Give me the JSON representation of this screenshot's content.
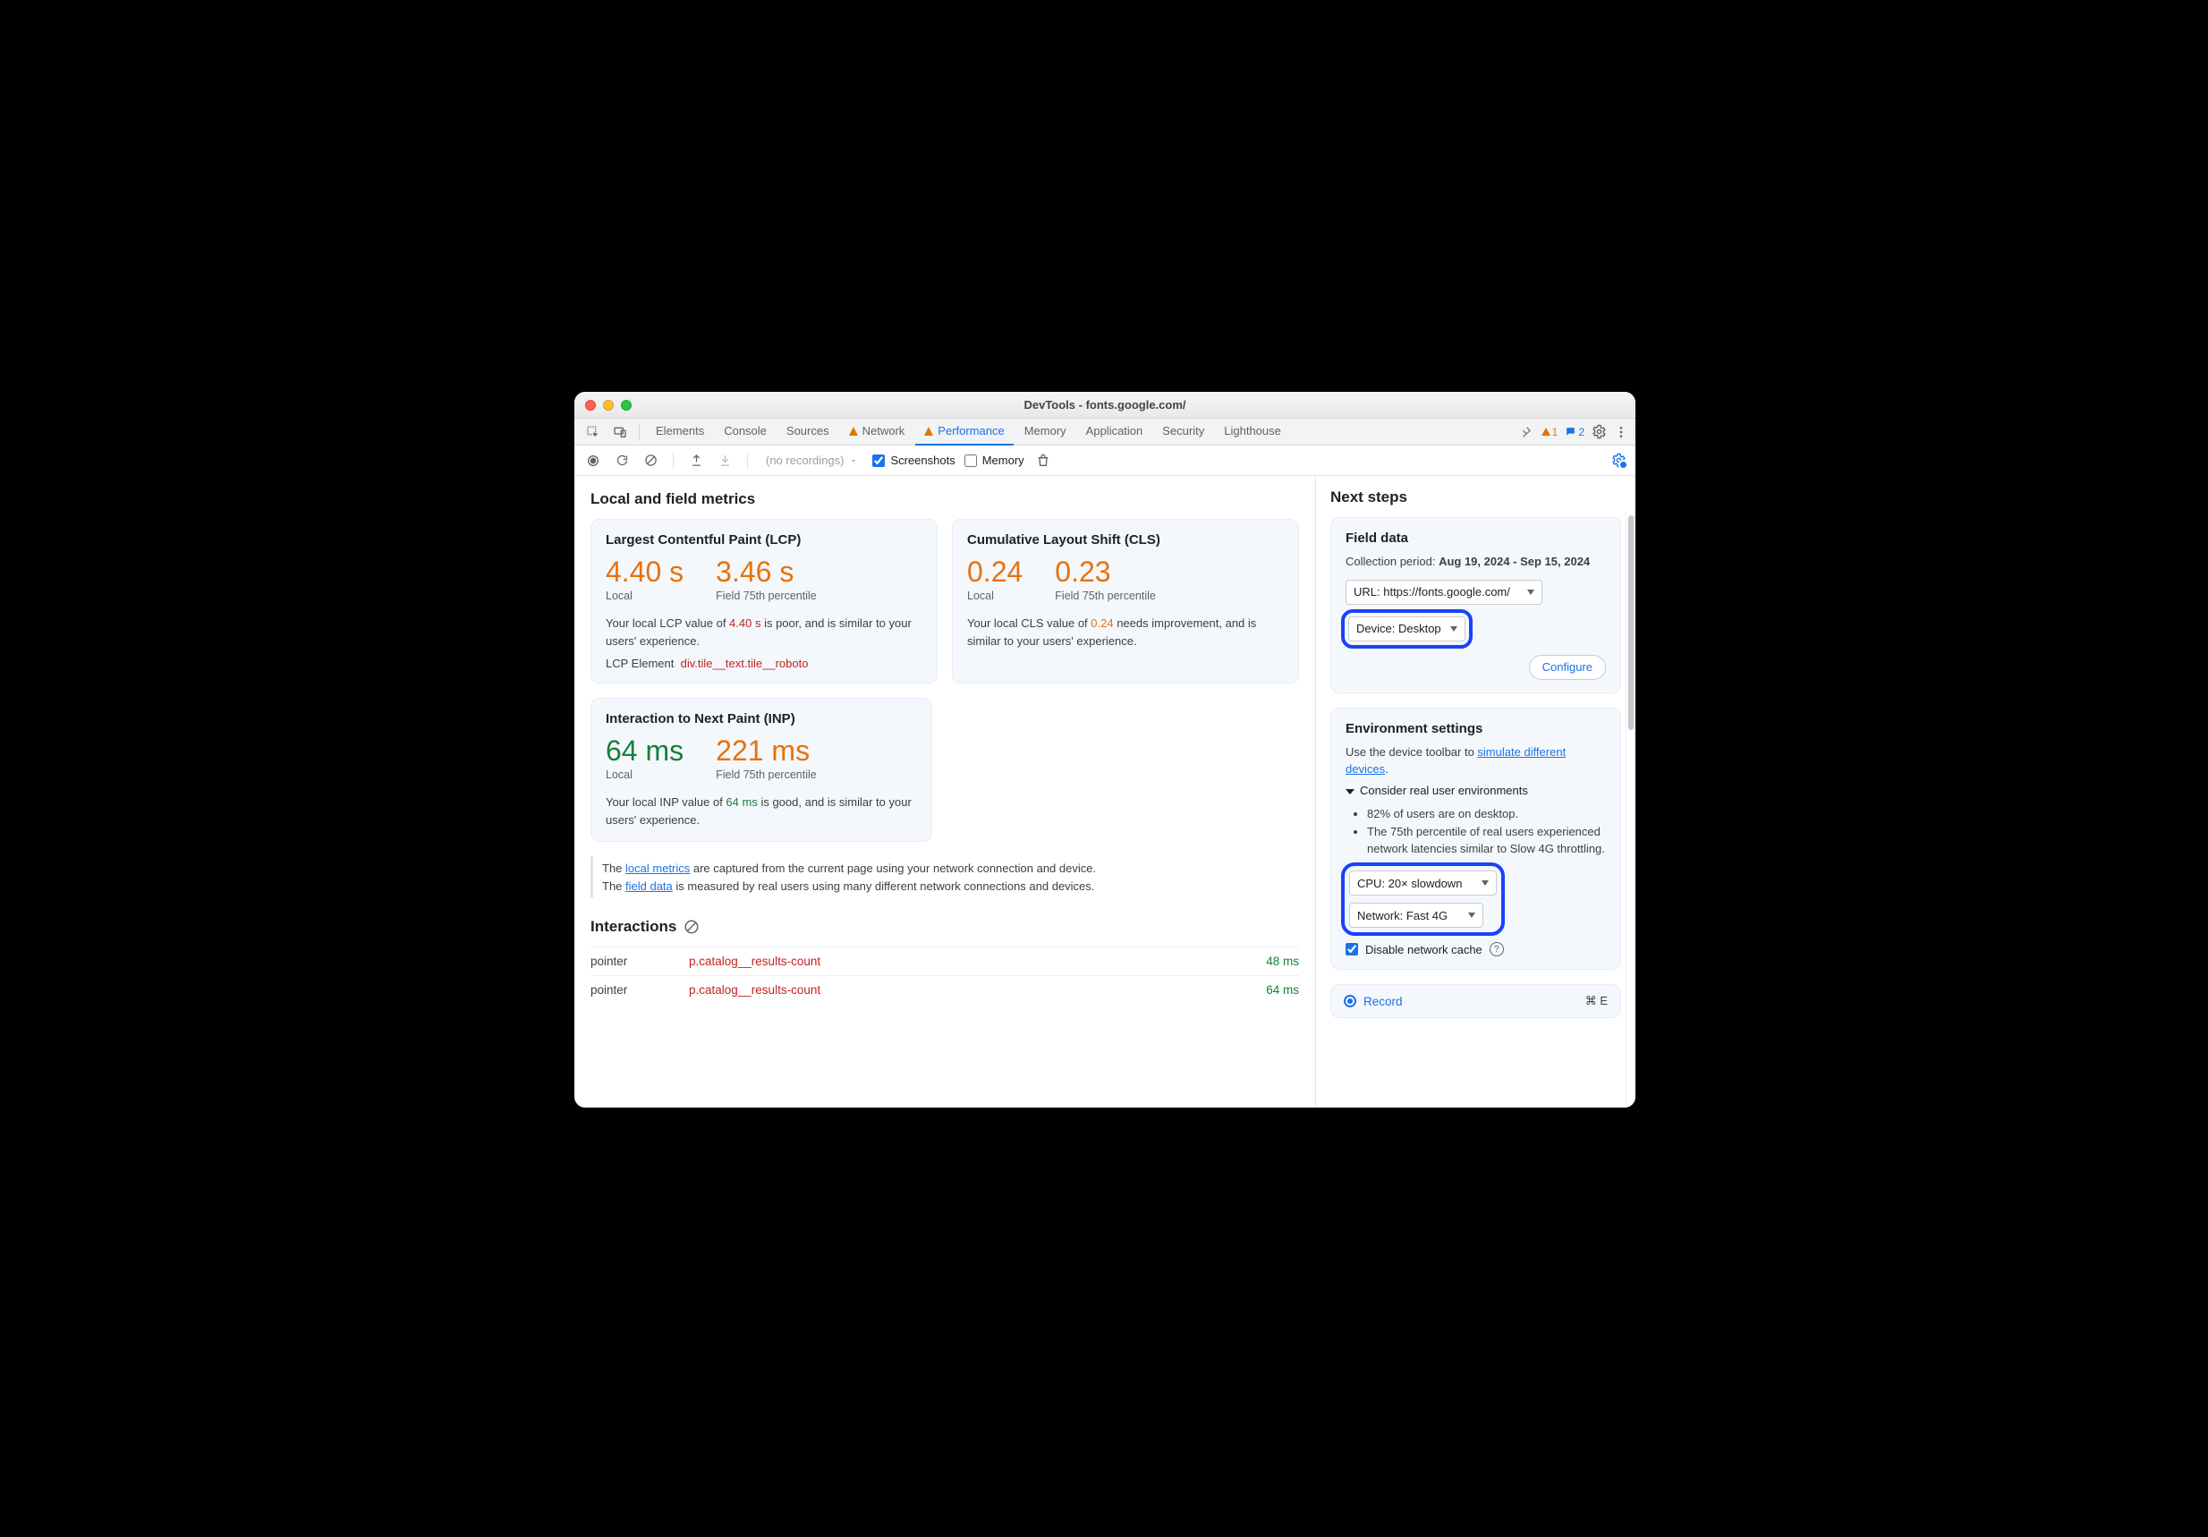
{
  "window": {
    "title": "DevTools - fonts.google.com/"
  },
  "tabs": [
    "Elements",
    "Console",
    "Sources",
    "Network",
    "Performance",
    "Memory",
    "Application",
    "Security",
    "Lighthouse"
  ],
  "tabs_warn_index": [
    3,
    4
  ],
  "tabs_active_index": 4,
  "tab_counts": {
    "warnings": "1",
    "messages": "2"
  },
  "recordings_placeholder": "(no recordings)",
  "screenshots_label": "Screenshots",
  "memory_label": "Memory",
  "main_heading": "Local and field metrics",
  "lcp": {
    "title": "Largest Contentful Paint (LCP)",
    "local_value": "4.40 s",
    "local_label": "Local",
    "field_value": "3.46 s",
    "field_label": "Field 75th percentile",
    "desc_pre": "Your local LCP value of ",
    "desc_val": "4.40 s",
    "desc_post": " is poor, and is similar to your users' experience.",
    "element_label": "LCP Element",
    "element_selector": "div.tile__text.tile__roboto"
  },
  "cls": {
    "title": "Cumulative Layout Shift (CLS)",
    "local_value": "0.24",
    "local_label": "Local",
    "field_value": "0.23",
    "field_label": "Field 75th percentile",
    "desc_pre": "Your local CLS value of ",
    "desc_val": "0.24",
    "desc_post": " needs improvement, and is similar to your users' experience."
  },
  "inp": {
    "title": "Interaction to Next Paint (INP)",
    "local_value": "64 ms",
    "local_label": "Local",
    "field_value": "221 ms",
    "field_label": "Field 75th percentile",
    "desc_pre": "Your local INP value of ",
    "desc_val": "64 ms",
    "desc_post": " is good, and is similar to your users' experience."
  },
  "note": {
    "local_link": "local metrics",
    "local_rest": " are captured from the current page using your network connection and device.",
    "field_link": "field data",
    "field_rest": " is measured by real users using many different network connections and devices.",
    "prefix": "The "
  },
  "interactions": {
    "heading": "Interactions",
    "rows": [
      {
        "kind": "pointer",
        "selector": "p.catalog__results-count",
        "ms": "48 ms"
      },
      {
        "kind": "pointer",
        "selector": "p.catalog__results-count",
        "ms": "64 ms"
      }
    ]
  },
  "side": {
    "heading": "Next steps",
    "field_data": {
      "title": "Field data",
      "period_label": "Collection period: ",
      "period_value": "Aug 19, 2024 - Sep 15, 2024",
      "url_select": "URL: https://fonts.google.com/",
      "device_select": "Device: Desktop",
      "configure": "Configure"
    },
    "env": {
      "title": "Environment settings",
      "hint_pre": "Use the device toolbar to ",
      "hint_link": "simulate different devices",
      "hint_post": ".",
      "details_summary": "Consider real user environments",
      "bullets": [
        "82% of users are on desktop.",
        "The 75th percentile of real users experienced network latencies similar to Slow 4G throttling."
      ],
      "cpu_select": "CPU: 20× slowdown",
      "net_select": "Network: Fast 4G",
      "disable_cache": "Disable network cache"
    },
    "record": {
      "label": "Record",
      "shortcut": "⌘ E"
    }
  }
}
